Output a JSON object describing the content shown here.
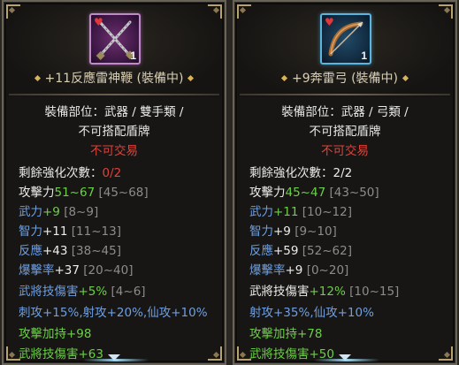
{
  "left": {
    "count": "1",
    "item_name": "+11反應雷神鞭 (裝備中)",
    "part_line": "裝備部位：武器 / 雙手類 /",
    "shield_line": "不可搭配盾牌",
    "trade": "不可交易",
    "enh": {
      "label": "剩餘強化次數：",
      "value": "0/2"
    },
    "stats": [
      {
        "name": "攻擊力",
        "bonus": "51~67",
        "range": " [45~68]",
        "name_color": "white",
        "bonus_color": "green"
      },
      {
        "name": "武力",
        "bonus": "+9",
        "range": " [8~9]",
        "name_color": "blue",
        "bonus_color": "green"
      },
      {
        "name": "智力",
        "bonus": "+11",
        "range": " [11~13]",
        "name_color": "blue",
        "bonus_color": "white"
      },
      {
        "name": "反應",
        "bonus": "+43",
        "range": " [38~45]",
        "name_color": "blue",
        "bonus_color": "white"
      },
      {
        "name": "爆擊率",
        "bonus": "+37",
        "range": " [20~40]",
        "name_color": "blue",
        "bonus_color": "white"
      },
      {
        "name": "武將技傷害",
        "bonus": "+5%",
        "range": " [4~6]",
        "name_color": "blue",
        "bonus_color": "green"
      }
    ],
    "attack_line": "刺攻+15%,射攻+20%,仙攻+10%",
    "extra1": "攻擊加持+98",
    "extra2": "武將技傷害+63"
  },
  "right": {
    "count": "1",
    "item_name": "+9奔雷弓 (裝備中)",
    "part_line": "裝備部位：武器 / 弓類 /",
    "shield_line": "不可搭配盾牌",
    "trade": "不可交易",
    "enh": {
      "label": "剩餘強化次數：",
      "value": "2/2"
    },
    "stats": [
      {
        "name": "攻擊力",
        "bonus": "45~47",
        "range": " [43~50]",
        "name_color": "white",
        "bonus_color": "green"
      },
      {
        "name": "武力",
        "bonus": "+11",
        "range": " [10~12]",
        "name_color": "blue",
        "bonus_color": "green"
      },
      {
        "name": "智力",
        "bonus": "+9",
        "range": " [9~10]",
        "name_color": "blue",
        "bonus_color": "white"
      },
      {
        "name": "反應",
        "bonus": "+59",
        "range": " [52~62]",
        "name_color": "blue",
        "bonus_color": "white"
      },
      {
        "name": "爆擊率",
        "bonus": "+9",
        "range": " [0~20]",
        "name_color": "blue",
        "bonus_color": "white"
      },
      {
        "name": "武將技傷害",
        "bonus": "+12%",
        "range": " [10~15]",
        "name_color": "white",
        "bonus_color": "green"
      }
    ],
    "attack_line": "射攻+35%,仙攻+10%",
    "extra1": "攻擊加持+78",
    "extra2": "武將技傷害+50"
  },
  "icons": {
    "left_item": "crossed-whips-icon",
    "right_item": "bow-icon",
    "equipped_badge": "heart-icon",
    "scroll": "chevron-down-icon"
  },
  "colors": {
    "stat_bonus": "#6ccf48",
    "stat_name": "#6f9fe2",
    "untradeable": "#e0413a",
    "enh_left_value": "#e0413a"
  }
}
